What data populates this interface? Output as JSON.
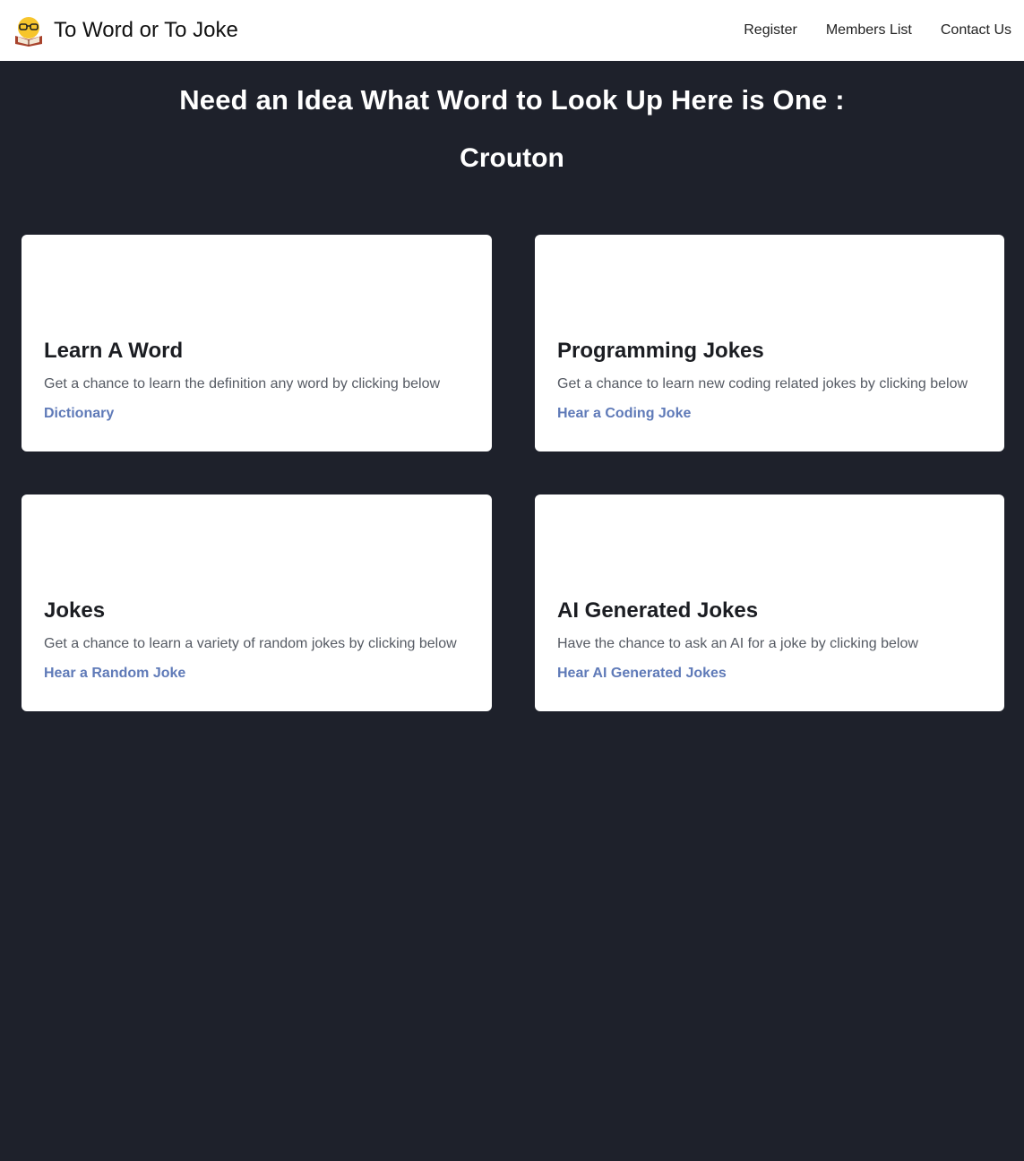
{
  "nav": {
    "brand_title": "To Word or To Joke",
    "logo_icon": "reading-emoji-icon",
    "links": [
      "Register",
      "Members List",
      "Contact Us"
    ]
  },
  "hero": {
    "heading": "Need an Idea What Word to Look Up Here is One :",
    "word": "Crouton"
  },
  "cards": [
    {
      "title": "Learn A Word",
      "description": "Get a chance to learn the definition any word by clicking below",
      "link": "Dictionary"
    },
    {
      "title": "Programming Jokes",
      "description": "Get a chance to learn new coding related jokes by clicking below",
      "link": "Hear a Coding Joke"
    },
    {
      "title": "Jokes",
      "description": "Get a chance to learn a variety of random jokes by clicking below",
      "link": "Hear a Random Joke"
    },
    {
      "title": "AI Generated Jokes",
      "description": "Have the chance to ask an AI for a joke by clicking below",
      "link": "Hear AI Generated Jokes"
    }
  ],
  "colors": {
    "page_background": "#1e212b",
    "card_background": "#ffffff",
    "link": "#5f7ab8"
  }
}
